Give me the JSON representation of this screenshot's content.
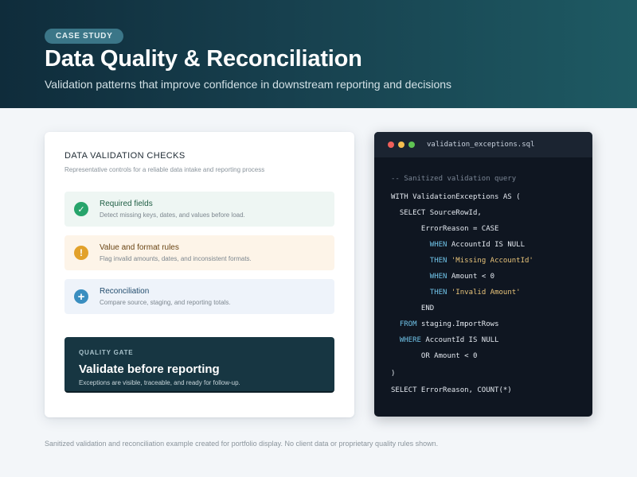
{
  "header": {
    "badge": "CASE STUDY",
    "title": "Data Quality & Reconciliation",
    "subtitle": "Validation patterns that improve confidence in downstream reporting and decisions"
  },
  "validation_card": {
    "title": "DATA VALIDATION CHECKS",
    "subtitle": "Representative controls for a reliable data intake and reporting process",
    "checks": [
      {
        "icon": "check-circle-icon",
        "label": "Required fields",
        "description": "Detect missing keys, dates, and values before load.",
        "color": "#27a46b"
      },
      {
        "icon": "warning-circle-icon",
        "label": "Value and format rules",
        "description": "Flag invalid amounts, dates, and inconsistent formats.",
        "color": "#e2a12a"
      },
      {
        "icon": "plus-circle-icon",
        "label": "Reconciliation",
        "description": "Compare source, staging, and reporting totals.",
        "color": "#3a8ec0"
      }
    ],
    "gate": {
      "kicker": "QUALITY GATE",
      "title": "Validate before reporting",
      "description": "Exceptions are visible, traceable, and ready for follow-up."
    }
  },
  "code_window": {
    "filename": "validation_exceptions.sql",
    "lines": [
      [
        {
          "t": "cm",
          "v": "-- Sanitized validation query"
        }
      ],
      [
        {
          "t": "pl",
          "v": "WITH ValidationExceptions AS ("
        }
      ],
      [
        {
          "t": "pl",
          "v": "  SELECT SourceRowId,"
        }
      ],
      [
        {
          "t": "pl",
          "v": "       ErrorReason = CASE"
        }
      ],
      [
        {
          "t": "pl",
          "v": "         "
        },
        {
          "t": "kw",
          "v": "WHEN"
        },
        {
          "t": "pl",
          "v": " AccountId IS NULL"
        }
      ],
      [
        {
          "t": "pl",
          "v": "         "
        },
        {
          "t": "kw",
          "v": "THEN"
        },
        {
          "t": "pl",
          "v": " "
        },
        {
          "t": "str",
          "v": "'Missing AccountId'"
        }
      ],
      [
        {
          "t": "pl",
          "v": "         "
        },
        {
          "t": "kw",
          "v": "WHEN"
        },
        {
          "t": "pl",
          "v": " Amount < 0"
        }
      ],
      [
        {
          "t": "pl",
          "v": "         "
        },
        {
          "t": "kw",
          "v": "THEN"
        },
        {
          "t": "pl",
          "v": " "
        },
        {
          "t": "str",
          "v": "'Invalid Amount'"
        }
      ],
      [
        {
          "t": "pl",
          "v": "       END"
        }
      ],
      [
        {
          "t": "pl",
          "v": "  "
        },
        {
          "t": "kw",
          "v": "FROM"
        },
        {
          "t": "pl",
          "v": " staging.ImportRows"
        }
      ],
      [
        {
          "t": "pl",
          "v": "  "
        },
        {
          "t": "kw",
          "v": "WHERE"
        },
        {
          "t": "pl",
          "v": " AccountId IS NULL"
        }
      ],
      [
        {
          "t": "pl",
          "v": "       OR Amount < 0"
        }
      ],
      [
        {
          "t": "pl",
          "v": ")"
        }
      ],
      [
        {
          "t": "pl",
          "v": "SELECT ErrorReason, COUNT(*)"
        }
      ]
    ]
  },
  "footer": "Sanitized validation and reconciliation example created for portfolio display. No client data or proprietary quality rules shown."
}
